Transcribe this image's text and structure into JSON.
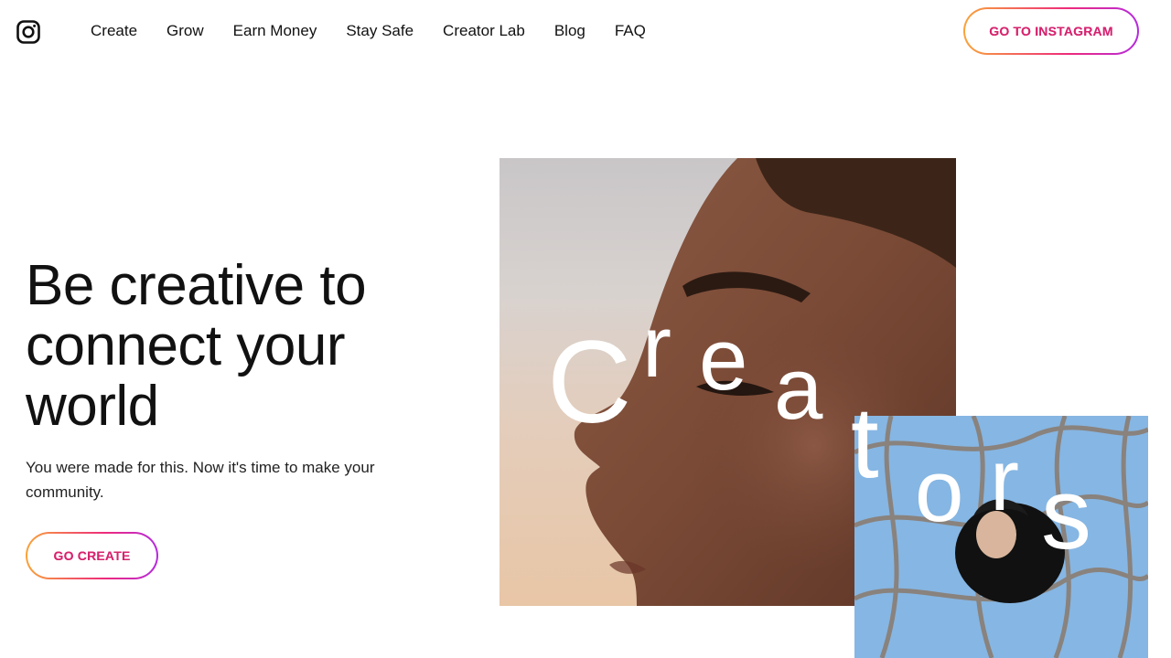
{
  "header": {
    "logo_icon": "instagram-icon",
    "nav": [
      {
        "label": "Create"
      },
      {
        "label": "Grow"
      },
      {
        "label": "Earn Money"
      },
      {
        "label": "Stay Safe"
      },
      {
        "label": "Creator Lab"
      },
      {
        "label": "Blog"
      },
      {
        "label": "FAQ"
      }
    ],
    "cta_label": "GO TO INSTAGRAM"
  },
  "hero": {
    "title": "Be creative to connect your world",
    "subtitle": "You were made for this. Now it's time to make your community.",
    "cta_label": "GO CREATE"
  },
  "collage": {
    "word_letters": [
      "C",
      "r",
      "e",
      "a",
      "t",
      "o",
      "r",
      "s"
    ]
  },
  "colors": {
    "gradient_start": "#f9a43a",
    "gradient_mid": "#ee2a7b",
    "gradient_end": "#b52ae0",
    "cta_text": "#d6246e"
  }
}
